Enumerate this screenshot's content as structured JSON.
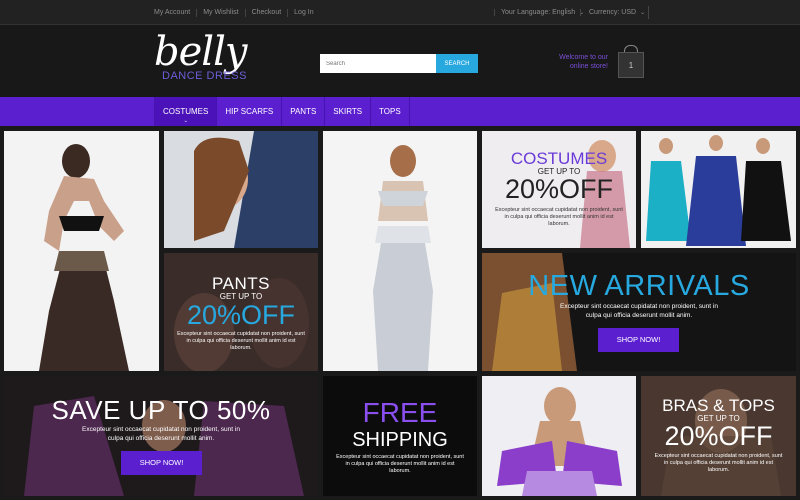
{
  "topbar": {
    "links": [
      "My Account",
      "My Wishlist",
      "Checkout",
      "Log In"
    ],
    "language_label": "Your Language: English",
    "currency_label": "Currency: USD"
  },
  "header": {
    "logo_script": "belly",
    "logo_sub": "DANCE DRESS",
    "search_placeholder": "Search",
    "search_button": "SEARCH",
    "welcome": "Welcome to our online store!",
    "cart_count": "1"
  },
  "nav": {
    "items": [
      "COSTUMES",
      "HIP SCARFS",
      "PANTS",
      "SKIRTS",
      "TOPS"
    ]
  },
  "tiles": {
    "costumes": {
      "title": "COSTUMES",
      "get_up": "GET UP TO",
      "off": "20%OFF",
      "text": "Excepteur sint occaecat cupidatat non proident, sunt in culpa qui officia deserunt mollit anim id est laborum."
    },
    "pants": {
      "title": "PANTS",
      "get_up": "GET UP TO",
      "off": "20%OFF",
      "text": "Excepteur sint occaecat cupidatat non proident, sunt in culpa qui officia deserunt mollit anim id est laborum."
    },
    "new_arrivals": {
      "title": "NEW ARRIVALS",
      "text": "Excepteur sint occaecat cupidatat non proident, sunt in culpa qui officia deserunt mollit anim.",
      "button": "SHOP NOW!"
    },
    "save": {
      "title": "SAVE UP TO 50%",
      "text": "Excepteur sint occaecat cupidatat non proident, sunt in culpa qui officia deserunt mollit anim.",
      "button": "SHOP NOW!"
    },
    "free_shipping": {
      "title1": "FREE",
      "title2": "SHIPPING",
      "text": "Excepteur sint occaecat cupidatat non proident, sunt in culpa qui officia deserunt mollit anim id est laborum."
    },
    "bras": {
      "title": "BRAS & TOPS",
      "get_up": "GET UP TO",
      "off": "20%OFF",
      "text": "Excepteur sint occaecat cupidatat non proident, sunt in culpa qui officia deserunt mollit anim id est laborum."
    }
  },
  "colors": {
    "nav_purple": "#5b1fcf",
    "accent_blue": "#27a9e0",
    "title_purple": "#6a3bd8"
  }
}
